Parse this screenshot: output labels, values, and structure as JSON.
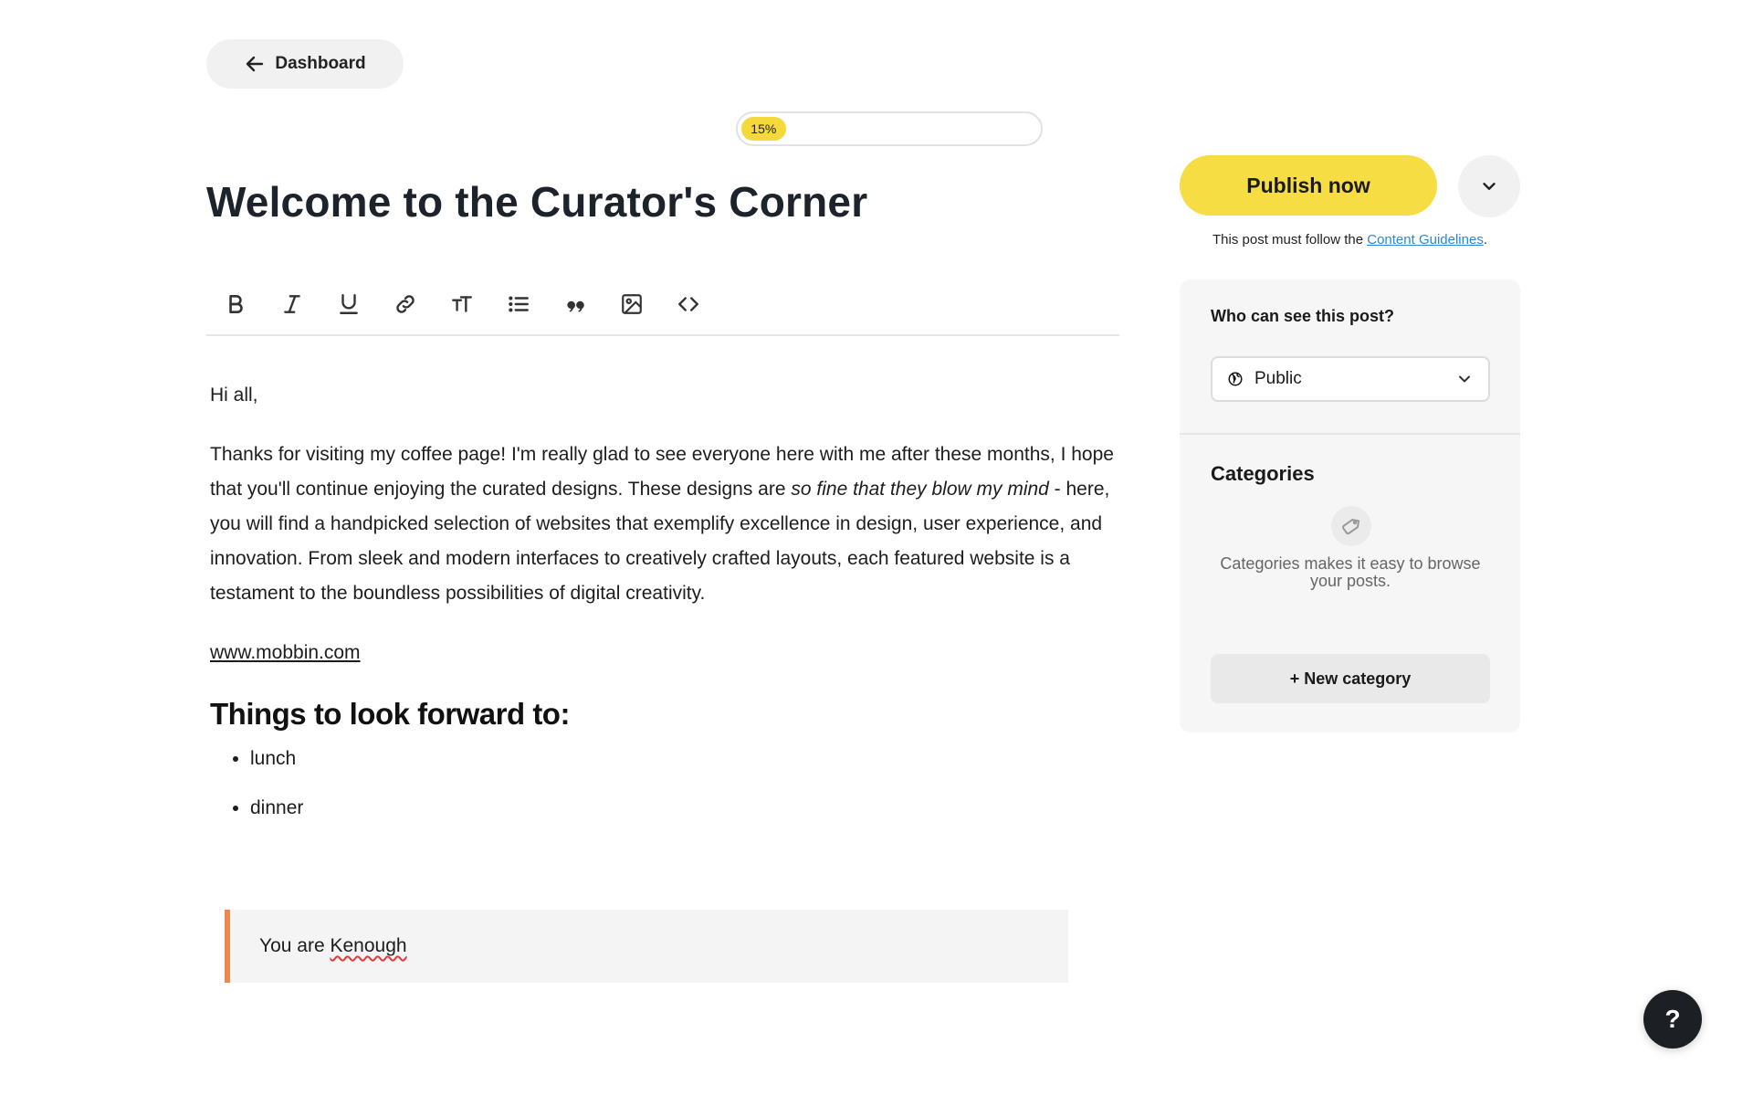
{
  "nav": {
    "back_label": "Dashboard"
  },
  "progress": {
    "label": "15%",
    "value": 15
  },
  "post": {
    "title": "Welcome to the Curator's Corner",
    "greeting": "Hi all,",
    "para_part1": "Thanks for visiting my coffee page! I'm really glad to see everyone here with me after these months, I hope that you'll continue enjoying the curated designs. These designs are ",
    "para_italic": "so fine that they blow my mind",
    "para_part2": " - here, you will find a handpicked selection of websites that exemplify excellence in design, user experience, and innovation. From sleek and modern interfaces to creatively crafted layouts, each featured website is a testament to the boundless possibilities of digital creativity.",
    "link": "www.mobbin.com",
    "heading": "Things to look forward to:",
    "list": [
      "lunch",
      "dinner"
    ],
    "quote_prefix": "You are ",
    "quote_word": "Kenough"
  },
  "toolbar": {
    "icons": [
      "bold-icon",
      "italic-icon",
      "underline-icon",
      "link-icon",
      "text-size-icon",
      "bullet-list-icon",
      "quote-icon",
      "image-icon",
      "code-icon"
    ]
  },
  "sidebar": {
    "publish_label": "Publish now",
    "guidelines_prefix": "This post must follow the ",
    "guidelines_link": "Content Guidelines",
    "guidelines_suffix": ".",
    "visibility_title": "Who can see this post?",
    "visibility_value": "Public",
    "categories_title": "Categories",
    "categories_desc": "Categories makes it easy to browse your posts.",
    "new_category_label": "+ New category"
  },
  "help": {
    "label": "?"
  },
  "colors": {
    "accent": "#f6dd44",
    "quote_border": "#f0874f",
    "link": "#2f86d6"
  }
}
